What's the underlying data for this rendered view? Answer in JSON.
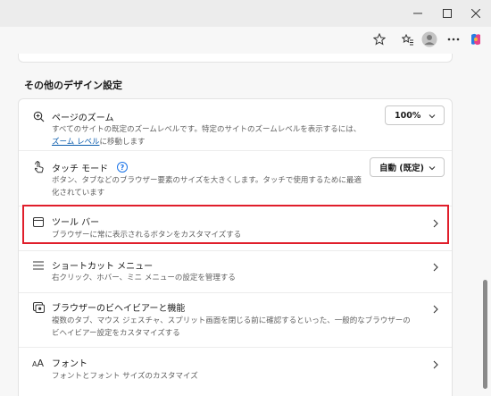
{
  "section": {
    "title": "その他のデザイン設定"
  },
  "settings": {
    "zoom": {
      "title": "ページのズーム",
      "desc1": "すべてのサイトの既定のズームレベルです。特定のサイトのズームレベルを表示するには、",
      "desc_link": "ズーム レベル",
      "desc2": "に移動します",
      "value": "100%",
      "icon": "zoom-in-icon"
    },
    "touch": {
      "title": "タッチ モード",
      "help": "?",
      "desc1": "ボタン、タブなどのブラウザー要素のサイズを大きくします。タッチで使用するために最適",
      "desc2": "化されています",
      "value": "自動 (既定)",
      "icon": "touch-hand-icon"
    },
    "toolbar": {
      "title": "ツール バー",
      "desc": "ブラウザーに常に表示されるボタンをカスタマイズする",
      "icon": "toolbar-window-icon"
    },
    "context_menu": {
      "title": "ショートカット メニュー",
      "desc": "右クリック、ホバー、ミニ メニューの設定を管理する",
      "icon": "menu-lines-icon"
    },
    "browser_behavior": {
      "title": "ブラウザーのビヘイビアーと機能",
      "desc1": "複数のタブ、マウス ジェスチャ、スプリット画面を閉じる前に確認するといった、一般的なブラウザーの",
      "desc2": "ビヘイビアー設定をカスタマイズする",
      "icon": "browser-feature-icon"
    },
    "fonts": {
      "title": "フォント",
      "desc": "フォントとフォント サイズのカスタマイズ",
      "icon": "font-aa-icon"
    }
  },
  "colors": {
    "highlight": "#e01e2b",
    "link": "#0b5cad",
    "accent": "#1a73e8"
  }
}
